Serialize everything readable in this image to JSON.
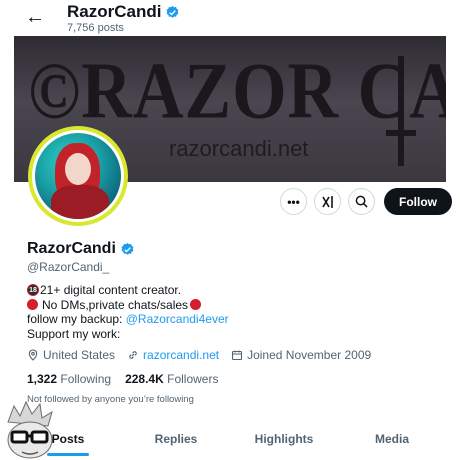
{
  "header": {
    "title": "RazorCandi",
    "posts_count": "7,756 posts",
    "back_icon": "arrow-left-icon"
  },
  "banner": {
    "watermark": "©RAZOR CANDI",
    "url": "razorcandi.net"
  },
  "actions": {
    "more_label": "•••",
    "grok_label": "X",
    "search_icon": "search-icon",
    "follow_label": "Follow"
  },
  "profile": {
    "name": "RazorCandi",
    "handle": "@RazorCandi_",
    "bio": {
      "line1_badge": "18",
      "line1": "21+ digital content creator.",
      "line2": "No DMs,private chats/sales",
      "line3_prefix": "follow my backup: ",
      "line3_link": "@Razorcandi4ever",
      "line4": "Support my work:"
    },
    "location": "United States",
    "website": "razorcandi.net",
    "joined": "Joined November 2009",
    "following_count": "1,322",
    "following_label": "Following",
    "followers_count": "228.4K",
    "followers_label": "Followers",
    "not_followed": "Not followed by anyone you’re following"
  },
  "tabs": [
    {
      "label": "Posts",
      "active": true
    },
    {
      "label": "Replies",
      "active": false
    },
    {
      "label": "Highlights",
      "active": false
    },
    {
      "label": "Media",
      "active": false
    }
  ],
  "colors": {
    "accent": "#1d9bf0",
    "avatar_ring": "#d9e72f",
    "text": "#0f1419",
    "muted": "#536471"
  }
}
